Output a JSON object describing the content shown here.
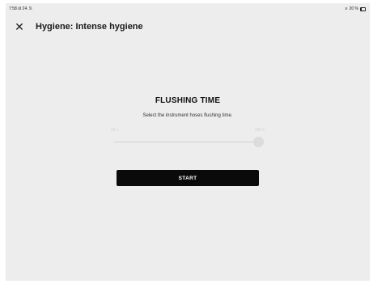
{
  "status_bar": {
    "time_date": "7:58  út 24. 9.",
    "battery_text": "20 %",
    "battery_level": 0.2,
    "wifi_icon": "wifi-icon"
  },
  "header": {
    "close_icon": "close-icon",
    "title": "Hygiene: Intense hygiene"
  },
  "main": {
    "heading": "FLUSHING TIME",
    "subtitle": "Select the instrument hoses flushing time.",
    "slider": {
      "min_label": "20 s",
      "max_label": "120 s",
      "value_fraction": 1.0
    },
    "start_label": "START"
  },
  "colors": {
    "background": "#ededed",
    "button": "#0a0a0a",
    "slider_disabled": "#dcdcdc"
  }
}
